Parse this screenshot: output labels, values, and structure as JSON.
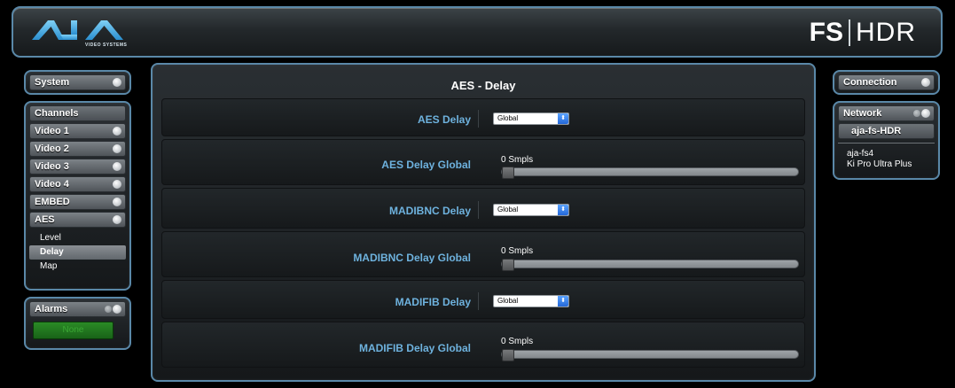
{
  "header": {
    "logo_text": "AJA",
    "logo_sub": "VIDEO SYSTEMS",
    "product_fs": "FS",
    "product_hdr": "HDR"
  },
  "left": {
    "system_label": "System",
    "channels_label": "Channels",
    "channels": [
      "Video 1",
      "Video 2",
      "Video 3",
      "Video 4",
      "EMBED",
      "AES"
    ],
    "aes_subitems": [
      "Level",
      "Delay",
      "Map"
    ],
    "active_subitem": "Delay",
    "alarms_label": "Alarms",
    "alarms_status": "None"
  },
  "main": {
    "title": "AES - Delay",
    "rows": [
      {
        "label": "AES Delay",
        "type": "select",
        "value": "Global"
      },
      {
        "label": "AES Delay Global",
        "type": "slider",
        "value_text": "0 Smpls",
        "fraction": 0
      },
      {
        "label": "MADIBNC Delay",
        "type": "select",
        "value": "Global"
      },
      {
        "label": "MADIBNC Delay Global",
        "type": "slider",
        "value_text": "0 Smpls",
        "fraction": 0
      },
      {
        "label": "MADIFIB Delay",
        "type": "select",
        "value": "Global"
      },
      {
        "label": "MADIFIB Delay Global",
        "type": "slider",
        "value_text": "0 Smpls",
        "fraction": 0
      }
    ]
  },
  "right": {
    "connection_label": "Connection",
    "network_label": "Network",
    "current_device": "aja-fs-HDR",
    "devices": [
      "aja-fs4",
      "Ki Pro Ultra Plus"
    ]
  },
  "colors": {
    "accent_border": "#5a88a8",
    "label_blue": "#6eb2de",
    "alarm_green": "#2b8a26"
  }
}
